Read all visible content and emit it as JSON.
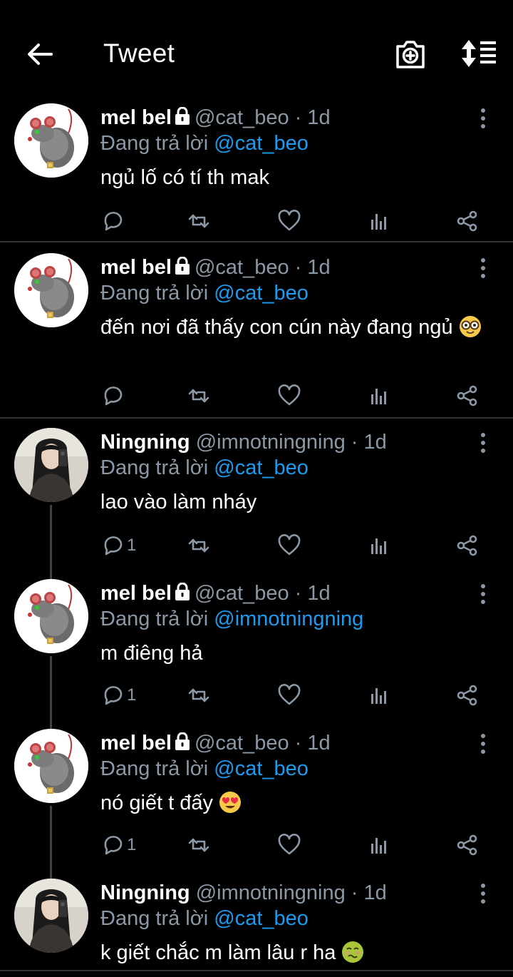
{
  "header": {
    "title": "Tweet",
    "back_icon": "arrow-left-icon",
    "camera_icon": "camera-plus-icon",
    "sort_icon": "sort-icon"
  },
  "colors": {
    "background": "#000000",
    "text": "#ffffff",
    "muted": "#8b98a5",
    "link": "#1d9bf0",
    "divider": "#2f3336"
  },
  "tweets": [
    {
      "name": "mel bel",
      "locked": true,
      "handle": "@cat_beo",
      "time": "· 1d",
      "reply_prefix": "Đang trả lời",
      "reply_to": "@cat_beo",
      "text": "ngủ lố có tí th mak",
      "emoji": "",
      "replies": "",
      "avatar": "rat"
    },
    {
      "name": "mel bel",
      "locked": true,
      "handle": "@cat_beo",
      "time": "· 1d",
      "reply_prefix": "Đang trả lời",
      "reply_to": "@cat_beo",
      "text": "đến nơi đã thấy con cún này đang ngủ",
      "emoji": "nerd-face",
      "replies": "",
      "avatar": "rat"
    },
    {
      "name": "Ningning",
      "locked": false,
      "handle": "@imnotningning",
      "time": "· 1d",
      "reply_prefix": "Đang trả lời",
      "reply_to": "@cat_beo",
      "text": "lao vào làm nháy",
      "emoji": "",
      "replies": "1",
      "avatar": "girl"
    },
    {
      "name": "mel bel",
      "locked": true,
      "handle": "@cat_beo",
      "time": "· 1d",
      "reply_prefix": "Đang trả lời",
      "reply_to": "@imnotningning",
      "text": "m điêng hả",
      "emoji": "",
      "replies": "1",
      "avatar": "rat"
    },
    {
      "name": "mel bel",
      "locked": true,
      "handle": "@cat_beo",
      "time": "· 1d",
      "reply_prefix": "Đang trả lời",
      "reply_to": "@cat_beo",
      "text": "nó giết t đấy",
      "emoji": "heart-eyes",
      "replies": "1",
      "avatar": "rat"
    },
    {
      "name": "Ningning",
      "locked": false,
      "handle": "@imnotningning",
      "time": "· 1d",
      "reply_prefix": "Đang trả lời",
      "reply_to": "@cat_beo",
      "text": "k giết chắc m làm lâu r ha",
      "emoji": "nauseated-face",
      "replies": "",
      "avatar": "girl"
    }
  ]
}
